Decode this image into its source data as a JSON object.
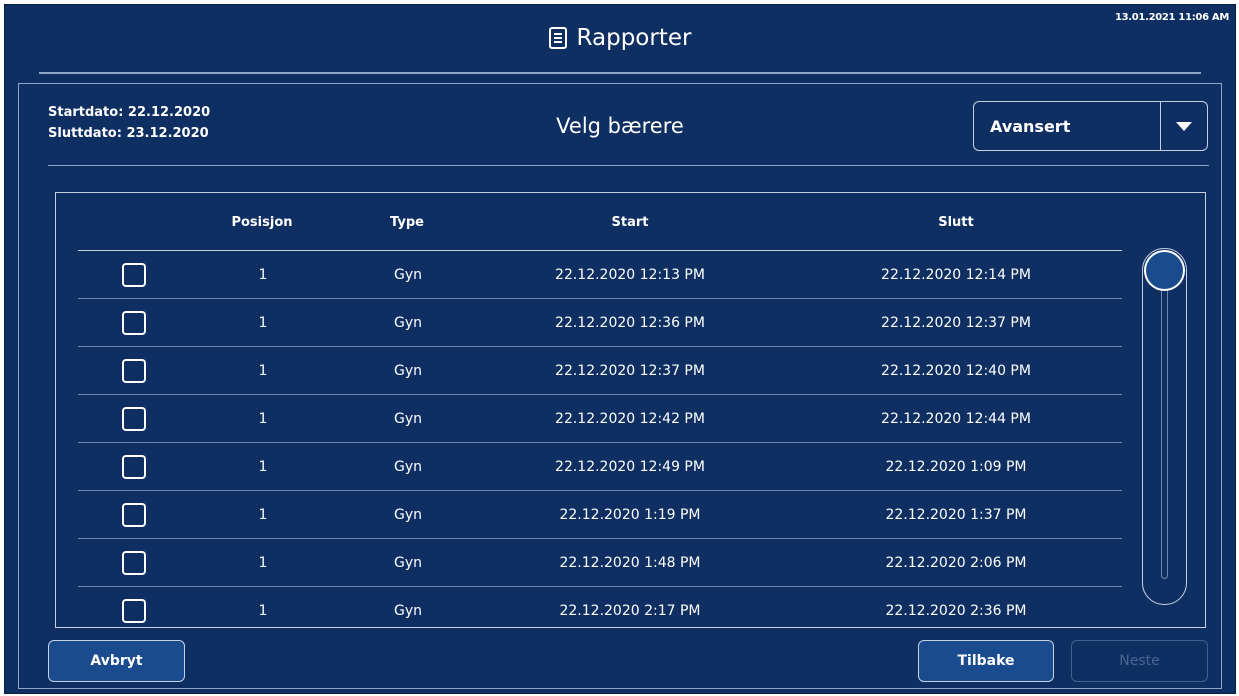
{
  "header": {
    "title": "Rapporter",
    "datetime": "13.01.2021 11:06 AM",
    "icon": "report-icon"
  },
  "info": {
    "start_label": "Startdato: 22.12.2020",
    "end_label": "Sluttdato: 23.12.2020"
  },
  "subtitle": "Velg bærere",
  "dropdown": {
    "selected": "Avansert",
    "icon": "chevron-down-icon"
  },
  "table": {
    "columns": [
      "Posisjon",
      "Type",
      "Start",
      "Slutt"
    ],
    "rows": [
      {
        "position": "1",
        "type": "Gyn",
        "start": "22.12.2020 12:13 PM",
        "end": "22.12.2020 12:14 PM"
      },
      {
        "position": "1",
        "type": "Gyn",
        "start": "22.12.2020 12:36 PM",
        "end": "22.12.2020 12:37 PM"
      },
      {
        "position": "1",
        "type": "Gyn",
        "start": "22.12.2020 12:37 PM",
        "end": "22.12.2020 12:40 PM"
      },
      {
        "position": "1",
        "type": "Gyn",
        "start": "22.12.2020 12:42 PM",
        "end": "22.12.2020 12:44 PM"
      },
      {
        "position": "1",
        "type": "Gyn",
        "start": "22.12.2020 12:49 PM",
        "end": "22.12.2020 1:09 PM"
      },
      {
        "position": "1",
        "type": "Gyn",
        "start": "22.12.2020 1:19 PM",
        "end": "22.12.2020 1:37 PM"
      },
      {
        "position": "1",
        "type": "Gyn",
        "start": "22.12.2020 1:48 PM",
        "end": "22.12.2020 2:06 PM"
      },
      {
        "position": "1",
        "type": "Gyn",
        "start": "22.12.2020 2:17 PM",
        "end": "22.12.2020 2:36 PM"
      }
    ]
  },
  "buttons": {
    "cancel": "Avbryt",
    "back": "Tilbake",
    "next": "Neste"
  },
  "colors": {
    "background": "#0f2f63",
    "button": "#1a4b8e",
    "border": "#c5d1e2",
    "disabled": "#4a6690"
  }
}
